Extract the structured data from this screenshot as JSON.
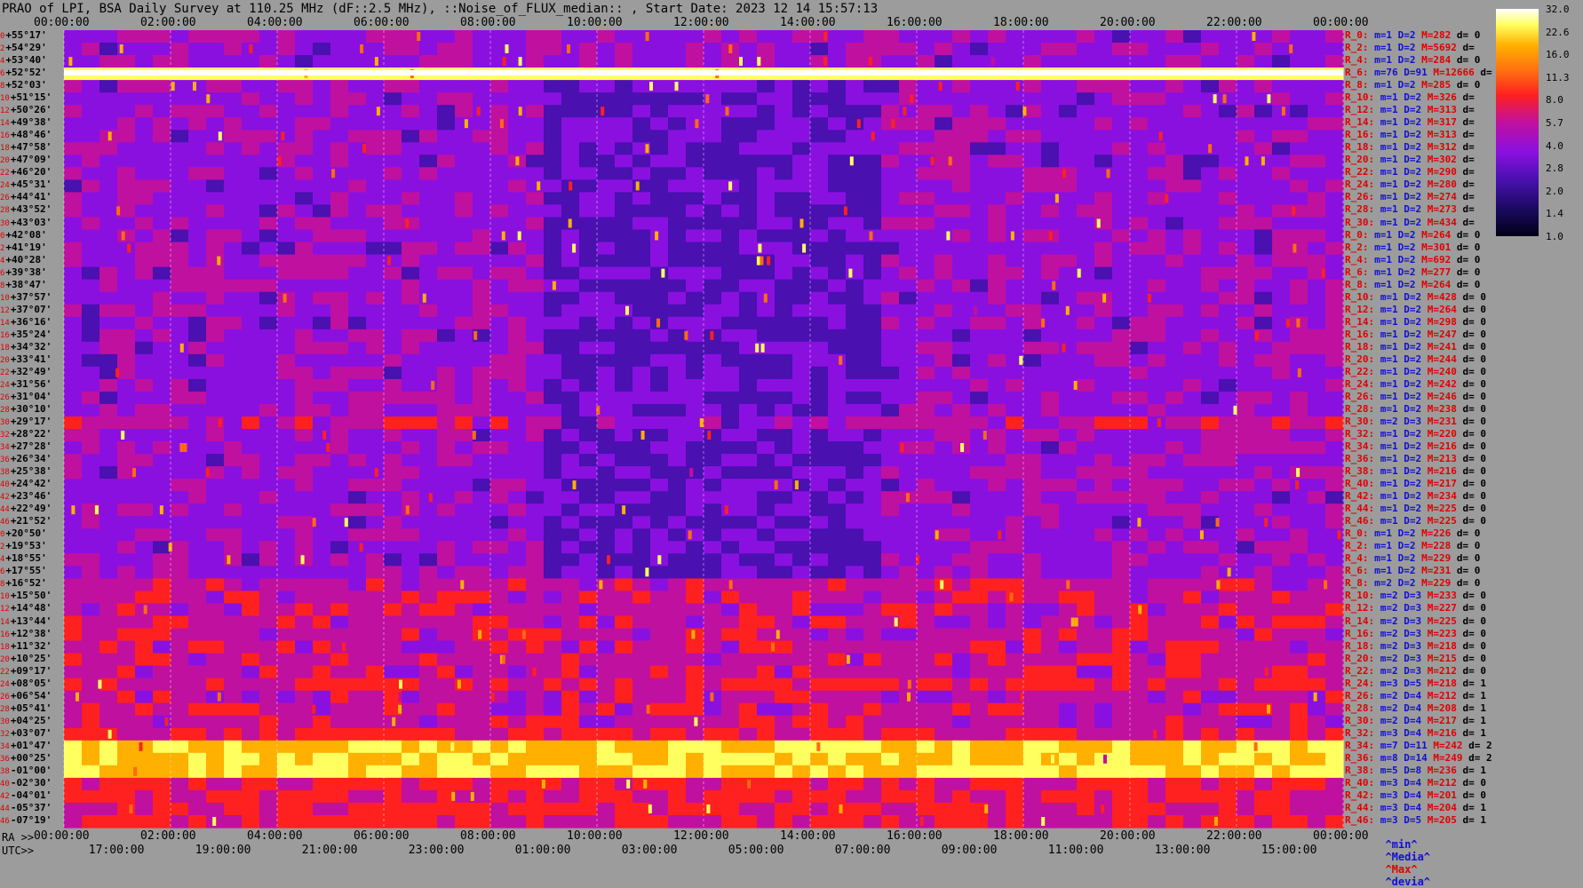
{
  "title": "PRAO of LPI, BSA Daily Survey at 110.25 MHz (dF::2.5 MHz), ::Noise_of_FLUX_median:: , Start Date: 2023 12 14 15:57:13",
  "axes": {
    "ra_label": "RA >>",
    "utc_label": "UTC>>",
    "top_ticks": [
      "00:00:00",
      "02:00:00",
      "04:00:00",
      "06:00:00",
      "08:00:00",
      "10:00:00",
      "12:00:00",
      "14:00:00",
      "16:00:00",
      "18:00:00",
      "20:00:00",
      "22:00:00",
      "00:00:00"
    ],
    "ra_ticks": [
      "00:00:00",
      "02:00:00",
      "04:00:00",
      "06:00:00",
      "08:00:00",
      "10:00:00",
      "12:00:00",
      "14:00:00",
      "16:00:00",
      "18:00:00",
      "20:00:00",
      "22:00:00",
      "00:00:00"
    ],
    "utc_ticks": [
      "17:00:00",
      "19:00:00",
      "21:00:00",
      "23:00:00",
      "01:00:00",
      "03:00:00",
      "05:00:00",
      "07:00:00",
      "09:00:00",
      "11:00:00",
      "13:00:00",
      "15:00:00"
    ]
  },
  "colorbar": {
    "ticks": [
      "32.0",
      "22.6",
      "16.0",
      "11.3",
      "8.0",
      "5.7",
      "4.0",
      "2.8",
      "2.0",
      "1.4",
      "1.0"
    ],
    "min": 1.0,
    "max": 32.0,
    "scale": "log",
    "colors": [
      "#000018",
      "#1a0a60",
      "#4a10b0",
      "#8a10e0",
      "#c010a0",
      "#ff2020",
      "#ff6a10",
      "#ffb000",
      "#ffff60",
      "#ffffff"
    ]
  },
  "footer": {
    "min": "^min^",
    "median": "^Media^",
    "max": "^Max^",
    "devia": "^devia^"
  },
  "chart_data": {
    "type": "heatmap",
    "title": "PRAO of LPI, BSA Daily Survey at 110.25 MHz (dF::2.5 MHz), ::Noise_of_FLUX_median:: , Start Date: 2023 12 14 15:57:13",
    "x_axis": "RA 00:00:00 to 24:00:00",
    "rows": [
      {
        "idx": "0",
        "dec": "+55°17'",
        "stat": {
          "r": "R_0:",
          "m": "1",
          "d": "2",
          "max": "282",
          "dv": "0"
        }
      },
      {
        "idx": "2",
        "dec": "+54°29'",
        "stat": {
          "r": "R_2:",
          "m": "1",
          "d": "2",
          "max": "5692",
          "dv": ""
        }
      },
      {
        "idx": "4",
        "dec": "+53°40'",
        "stat": {
          "r": "R_4:",
          "m": "1",
          "d": "2",
          "max": "284",
          "dv": "0"
        }
      },
      {
        "idx": "6",
        "dec": "+52°52'",
        "stat": {
          "r": "R_6:",
          "m": "76",
          "d": "91",
          "max": "12666",
          "dv": ""
        }
      },
      {
        "idx": "8",
        "dec": "+52°03'",
        "stat": {
          "r": "R_8:",
          "m": "1",
          "d": "2",
          "max": "285",
          "dv": "0"
        }
      },
      {
        "idx": "10",
        "dec": "+51°15'",
        "stat": {
          "r": "R_10:",
          "m": "1",
          "d": "2",
          "max": "326",
          "dv": ""
        }
      },
      {
        "idx": "12",
        "dec": "+50°26'",
        "stat": {
          "r": "R_12:",
          "m": "1",
          "d": "2",
          "max": "313",
          "dv": ""
        }
      },
      {
        "idx": "14",
        "dec": "+49°38'",
        "stat": {
          "r": "R_14:",
          "m": "1",
          "d": "2",
          "max": "317",
          "dv": ""
        }
      },
      {
        "idx": "16",
        "dec": "+48°46'",
        "stat": {
          "r": "R_16:",
          "m": "1",
          "d": "2",
          "max": "313",
          "dv": ""
        }
      },
      {
        "idx": "18",
        "dec": "+47°58'",
        "stat": {
          "r": "R_18:",
          "m": "1",
          "d": "2",
          "max": "312",
          "dv": ""
        }
      },
      {
        "idx": "20",
        "dec": "+47°09'",
        "stat": {
          "r": "R_20:",
          "m": "1",
          "d": "2",
          "max": "302",
          "dv": ""
        }
      },
      {
        "idx": "22",
        "dec": "+46°20'",
        "stat": {
          "r": "R_22:",
          "m": "1",
          "d": "2",
          "max": "290",
          "dv": ""
        }
      },
      {
        "idx": "24",
        "dec": "+45°31'",
        "stat": {
          "r": "R_24:",
          "m": "1",
          "d": "2",
          "max": "280",
          "dv": ""
        }
      },
      {
        "idx": "26",
        "dec": "+44°41'",
        "stat": {
          "r": "R_26:",
          "m": "1",
          "d": "2",
          "max": "274",
          "dv": ""
        }
      },
      {
        "idx": "28",
        "dec": "+43°52'",
        "stat": {
          "r": "R_28:",
          "m": "1",
          "d": "2",
          "max": "273",
          "dv": ""
        }
      },
      {
        "idx": "30",
        "dec": "+43°03'",
        "stat": {
          "r": "R_30:",
          "m": "1",
          "d": "2",
          "max": "434",
          "dv": ""
        }
      },
      {
        "idx": "0",
        "dec": "+42°08'",
        "stat": {
          "r": "R_0:",
          "m": "1",
          "d": "2",
          "max": "264",
          "dv": "0"
        }
      },
      {
        "idx": "2",
        "dec": "+41°19'",
        "stat": {
          "r": "R_2:",
          "m": "1",
          "d": "2",
          "max": "301",
          "dv": "0"
        }
      },
      {
        "idx": "4",
        "dec": "+40°28'",
        "stat": {
          "r": "R_4:",
          "m": "1",
          "d": "2",
          "max": "692",
          "dv": "0"
        }
      },
      {
        "idx": "6",
        "dec": "+39°38'",
        "stat": {
          "r": "R_6:",
          "m": "1",
          "d": "2",
          "max": "277",
          "dv": "0"
        }
      },
      {
        "idx": "8",
        "dec": "+38°47'",
        "stat": {
          "r": "R_8:",
          "m": "1",
          "d": "2",
          "max": "264",
          "dv": "0"
        }
      },
      {
        "idx": "10",
        "dec": "+37°57'",
        "stat": {
          "r": "R_10:",
          "m": "1",
          "d": "2",
          "max": "428",
          "dv": "0"
        }
      },
      {
        "idx": "12",
        "dec": "+37°07'",
        "stat": {
          "r": "R_12:",
          "m": "1",
          "d": "2",
          "max": "264",
          "dv": "0"
        }
      },
      {
        "idx": "14",
        "dec": "+36°16'",
        "stat": {
          "r": "R_14:",
          "m": "1",
          "d": "2",
          "max": "298",
          "dv": "0"
        }
      },
      {
        "idx": "16",
        "dec": "+35°24'",
        "stat": {
          "r": "R_16:",
          "m": "1",
          "d": "2",
          "max": "247",
          "dv": "0"
        }
      },
      {
        "idx": "18",
        "dec": "+34°32'",
        "stat": {
          "r": "R_18:",
          "m": "1",
          "d": "2",
          "max": "241",
          "dv": "0"
        }
      },
      {
        "idx": "20",
        "dec": "+33°41'",
        "stat": {
          "r": "R_20:",
          "m": "1",
          "d": "2",
          "max": "244",
          "dv": "0"
        }
      },
      {
        "idx": "22",
        "dec": "+32°49'",
        "stat": {
          "r": "R_22:",
          "m": "1",
          "d": "2",
          "max": "240",
          "dv": "0"
        }
      },
      {
        "idx": "24",
        "dec": "+31°56'",
        "stat": {
          "r": "R_24:",
          "m": "1",
          "d": "2",
          "max": "242",
          "dv": "0"
        }
      },
      {
        "idx": "26",
        "dec": "+31°04'",
        "stat": {
          "r": "R_26:",
          "m": "1",
          "d": "2",
          "max": "246",
          "dv": "0"
        }
      },
      {
        "idx": "28",
        "dec": "+30°10'",
        "stat": {
          "r": "R_28:",
          "m": "1",
          "d": "2",
          "max": "238",
          "dv": "0"
        }
      },
      {
        "idx": "30",
        "dec": "+29°17'",
        "stat": {
          "r": "R_30:",
          "m": "2",
          "d": "3",
          "max": "231",
          "dv": "0"
        }
      },
      {
        "idx": "32",
        "dec": "+28°22'",
        "stat": {
          "r": "R_32:",
          "m": "1",
          "d": "2",
          "max": "220",
          "dv": "0"
        }
      },
      {
        "idx": "34",
        "dec": "+27°28'",
        "stat": {
          "r": "R_34:",
          "m": "1",
          "d": "2",
          "max": "216",
          "dv": "0"
        }
      },
      {
        "idx": "36",
        "dec": "+26°34'",
        "stat": {
          "r": "R_36:",
          "m": "1",
          "d": "2",
          "max": "213",
          "dv": "0"
        }
      },
      {
        "idx": "38",
        "dec": "+25°38'",
        "stat": {
          "r": "R_38:",
          "m": "1",
          "d": "2",
          "max": "216",
          "dv": "0"
        }
      },
      {
        "idx": "40",
        "dec": "+24°42'",
        "stat": {
          "r": "R_40:",
          "m": "1",
          "d": "2",
          "max": "217",
          "dv": "0"
        }
      },
      {
        "idx": "42",
        "dec": "+23°46'",
        "stat": {
          "r": "R_42:",
          "m": "1",
          "d": "2",
          "max": "234",
          "dv": "0"
        }
      },
      {
        "idx": "44",
        "dec": "+22°49'",
        "stat": {
          "r": "R_44:",
          "m": "1",
          "d": "2",
          "max": "225",
          "dv": "0"
        }
      },
      {
        "idx": "46",
        "dec": "+21°52'",
        "stat": {
          "r": "R_46:",
          "m": "1",
          "d": "2",
          "max": "225",
          "dv": "0"
        }
      },
      {
        "idx": "0",
        "dec": "+20°50'",
        "stat": {
          "r": "R_0:",
          "m": "1",
          "d": "2",
          "max": "226",
          "dv": "0"
        }
      },
      {
        "idx": "2",
        "dec": "+19°53'",
        "stat": {
          "r": "R_2:",
          "m": "1",
          "d": "2",
          "max": "228",
          "dv": "0"
        }
      },
      {
        "idx": "4",
        "dec": "+18°55'",
        "stat": {
          "r": "R_4:",
          "m": "1",
          "d": "2",
          "max": "229",
          "dv": "0"
        }
      },
      {
        "idx": "6",
        "dec": "+17°55'",
        "stat": {
          "r": "R_6:",
          "m": "1",
          "d": "2",
          "max": "231",
          "dv": "0"
        }
      },
      {
        "idx": "8",
        "dec": "+16°52'",
        "stat": {
          "r": "R_8:",
          "m": "2",
          "d": "2",
          "max": "229",
          "dv": "0"
        }
      },
      {
        "idx": "10",
        "dec": "+15°50'",
        "stat": {
          "r": "R_10:",
          "m": "2",
          "d": "3",
          "max": "233",
          "dv": "0"
        }
      },
      {
        "idx": "12",
        "dec": "+14°48'",
        "stat": {
          "r": "R_12:",
          "m": "2",
          "d": "3",
          "max": "227",
          "dv": "0"
        }
      },
      {
        "idx": "14",
        "dec": "+13°44'",
        "stat": {
          "r": "R_14:",
          "m": "2",
          "d": "3",
          "max": "225",
          "dv": "0"
        }
      },
      {
        "idx": "16",
        "dec": "+12°38'",
        "stat": {
          "r": "R_16:",
          "m": "2",
          "d": "3",
          "max": "223",
          "dv": "0"
        }
      },
      {
        "idx": "18",
        "dec": "+11°32'",
        "stat": {
          "r": "R_18:",
          "m": "2",
          "d": "3",
          "max": "218",
          "dv": "0"
        }
      },
      {
        "idx": "20",
        "dec": "+10°25'",
        "stat": {
          "r": "R_20:",
          "m": "2",
          "d": "3",
          "max": "215",
          "dv": "0"
        }
      },
      {
        "idx": "22",
        "dec": "+09°17'",
        "stat": {
          "r": "R_22:",
          "m": "2",
          "d": "3",
          "max": "212",
          "dv": "0"
        }
      },
      {
        "idx": "24",
        "dec": "+08°05'",
        "stat": {
          "r": "R_24:",
          "m": "3",
          "d": "5",
          "max": "218",
          "dv": "1"
        }
      },
      {
        "idx": "26",
        "dec": "+06°54'",
        "stat": {
          "r": "R_26:",
          "m": "2",
          "d": "4",
          "max": "212",
          "dv": "1"
        }
      },
      {
        "idx": "28",
        "dec": "+05°41'",
        "stat": {
          "r": "R_28:",
          "m": "2",
          "d": "4",
          "max": "208",
          "dv": "1"
        }
      },
      {
        "idx": "30",
        "dec": "+04°25'",
        "stat": {
          "r": "R_30:",
          "m": "2",
          "d": "4",
          "max": "217",
          "dv": "1"
        }
      },
      {
        "idx": "32",
        "dec": "+03°07'",
        "stat": {
          "r": "R_32:",
          "m": "3",
          "d": "4",
          "max": "216",
          "dv": "1"
        }
      },
      {
        "idx": "34",
        "dec": "+01°47'",
        "stat": {
          "r": "R_34:",
          "m": "7",
          "d": "11",
          "max": "242",
          "dv": "2"
        }
      },
      {
        "idx": "36",
        "dec": "+00°25'",
        "stat": {
          "r": "R_36:",
          "m": "8",
          "d": "14",
          "max": "249",
          "dv": "2"
        }
      },
      {
        "idx": "38",
        "dec": "-01°00'",
        "stat": {
          "r": "R_38:",
          "m": "5",
          "d": "8",
          "max": "236",
          "dv": "1"
        }
      },
      {
        "idx": "40",
        "dec": "-02°30'",
        "stat": {
          "r": "R_40:",
          "m": "3",
          "d": "4",
          "max": "212",
          "dv": "0"
        }
      },
      {
        "idx": "42",
        "dec": "-04°01'",
        "stat": {
          "r": "R_42:",
          "m": "3",
          "d": "4",
          "max": "201",
          "dv": "0"
        }
      },
      {
        "idx": "44",
        "dec": "-05°37'",
        "stat": {
          "r": "R_44:",
          "m": "3",
          "d": "4",
          "max": "204",
          "dv": "1"
        }
      },
      {
        "idx": "46",
        "dec": "-07°19'",
        "stat": {
          "r": "R_46:",
          "m": "3",
          "d": "5",
          "max": "205",
          "dv": "1"
        }
      }
    ]
  }
}
